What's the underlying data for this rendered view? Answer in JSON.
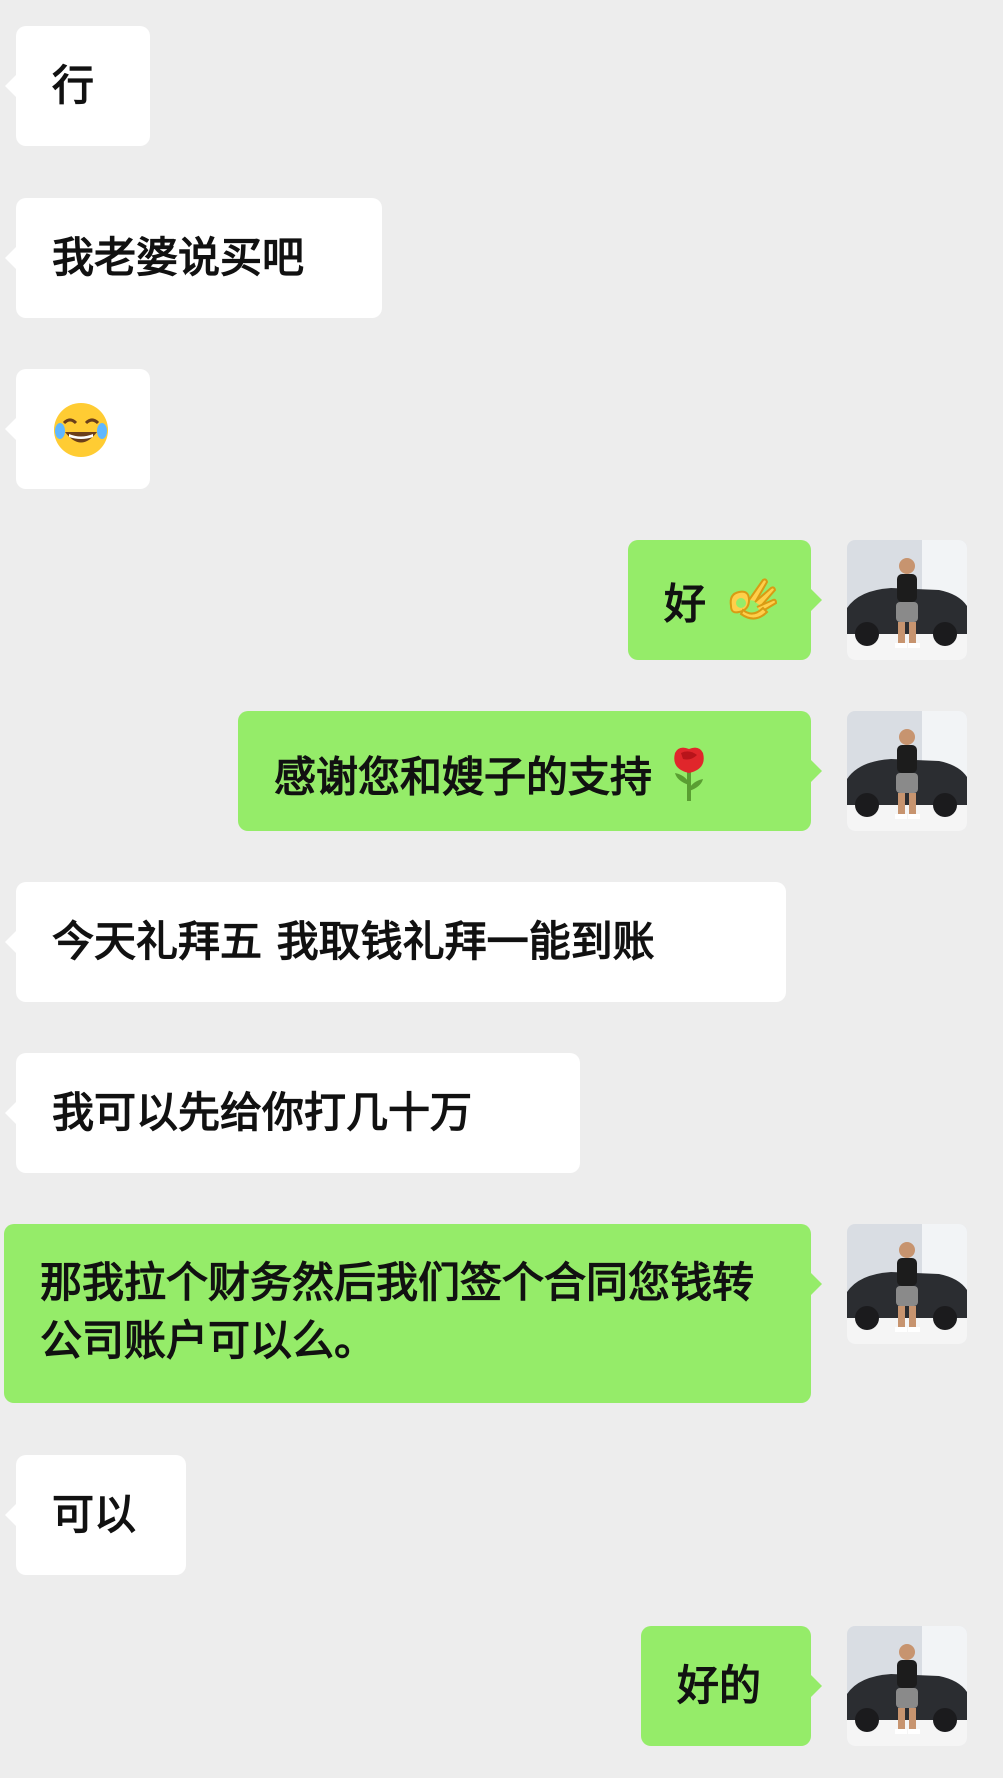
{
  "chat": {
    "messages": [
      {
        "side": "left",
        "text": "行"
      },
      {
        "side": "left",
        "text": "我老婆说买吧"
      },
      {
        "side": "left",
        "text": "",
        "emoji": "laughing-tears-emoji"
      },
      {
        "side": "right",
        "text": "好",
        "emoji": "ok-hand-emoji"
      },
      {
        "side": "right",
        "text": "感谢您和嫂子的支持",
        "emoji": "rose-emoji"
      },
      {
        "side": "left",
        "text": "今天礼拜五 我取钱礼拜一能到账"
      },
      {
        "side": "left",
        "text": "我可以先给你打几十万"
      },
      {
        "side": "right",
        "text": "那我拉个财务然后我们签个合同您钱转公司账户可以么。"
      },
      {
        "side": "left",
        "text": "可以"
      },
      {
        "side": "right",
        "text": "好的"
      }
    ]
  },
  "colors": {
    "background": "#ededed",
    "left_bubble": "#ffffff",
    "right_bubble": "#95ec69",
    "text": "#111111"
  }
}
